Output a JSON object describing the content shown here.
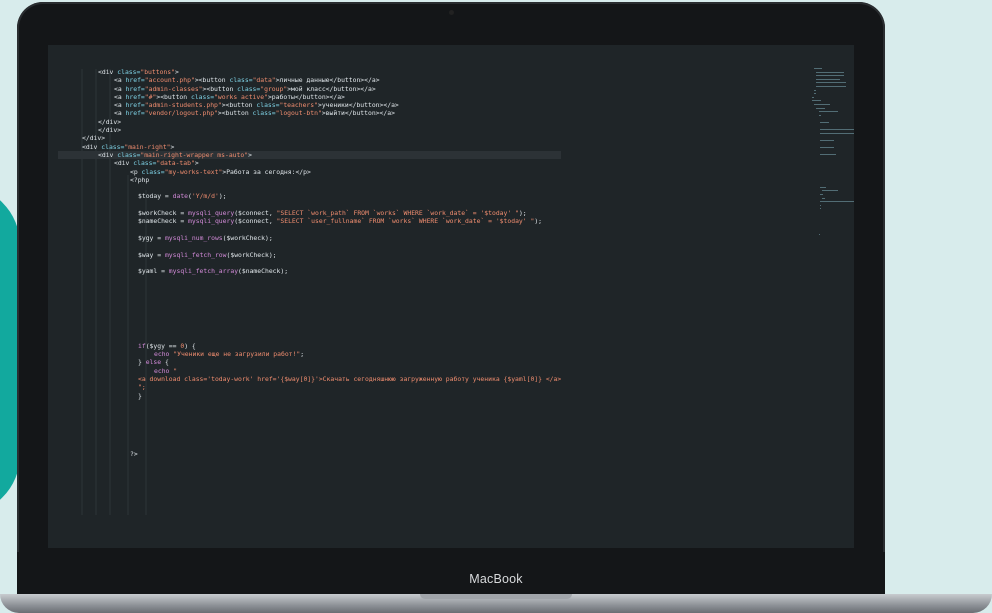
{
  "device": {
    "brand_label": "MacBook"
  },
  "colors": {
    "screen_bg": "#1f2528",
    "tag": "#e0e6ea",
    "attr": "#7fd3e6",
    "string": "#f08d6f",
    "function": "#d28ad8"
  },
  "code_lines": [
    {
      "indent": 5,
      "parts": [
        [
          "tg",
          "<div "
        ],
        [
          "at",
          "class="
        ],
        [
          "st",
          "\"buttons\""
        ],
        [
          "tg",
          ">"
        ]
      ]
    },
    {
      "indent": 7,
      "parts": [
        [
          "tg",
          "<a "
        ],
        [
          "at",
          "href="
        ],
        [
          "st",
          "\"account.php\""
        ],
        [
          "tg",
          "><button "
        ],
        [
          "at",
          "class="
        ],
        [
          "st",
          "\"data\""
        ],
        [
          "tg",
          ">личные данные</button></a>"
        ]
      ]
    },
    {
      "indent": 7,
      "parts": [
        [
          "tg",
          "<a "
        ],
        [
          "at",
          "href="
        ],
        [
          "st",
          "\"admin-classes\""
        ],
        [
          "tg",
          "><button "
        ],
        [
          "at",
          "class="
        ],
        [
          "st",
          "\"group\""
        ],
        [
          "tg",
          ">мой класс</button></a>"
        ]
      ]
    },
    {
      "indent": 7,
      "parts": [
        [
          "tg",
          "<a "
        ],
        [
          "at",
          "href="
        ],
        [
          "st",
          "\"#\""
        ],
        [
          "tg",
          "><button "
        ],
        [
          "at",
          "class="
        ],
        [
          "st",
          "\"works active\""
        ],
        [
          "tg",
          ">работы</button></a>"
        ]
      ]
    },
    {
      "indent": 7,
      "parts": [
        [
          "tg",
          "<a "
        ],
        [
          "at",
          "href="
        ],
        [
          "st",
          "\"admin-students.php\""
        ],
        [
          "tg",
          "><button "
        ],
        [
          "at",
          "class="
        ],
        [
          "st",
          "\"teachers\""
        ],
        [
          "tg",
          ">ученики</button></a>"
        ]
      ]
    },
    {
      "indent": 7,
      "parts": [
        [
          "tg",
          "<a "
        ],
        [
          "at",
          "href="
        ],
        [
          "st",
          "\"vendor/logout.php\""
        ],
        [
          "tg",
          "><button "
        ],
        [
          "at",
          "class="
        ],
        [
          "st",
          "\"logout-btn\""
        ],
        [
          "tg",
          ">выйти</button></a>"
        ]
      ]
    },
    {
      "indent": 5,
      "parts": [
        [
          "tg",
          "</div>"
        ]
      ]
    },
    {
      "indent": 5,
      "parts": [
        [
          "tg",
          "</div>"
        ]
      ]
    },
    {
      "indent": 3,
      "parts": [
        [
          "tg",
          "</div>"
        ]
      ]
    },
    {
      "indent": 3,
      "parts": [
        [
          "tg",
          "<div "
        ],
        [
          "at",
          "class="
        ],
        [
          "st",
          "\"main-right\""
        ],
        [
          "tg",
          ">"
        ]
      ]
    },
    {
      "indent": 5,
      "hl": true,
      "parts": [
        [
          "tg",
          "<div "
        ],
        [
          "at",
          "class="
        ],
        [
          "st",
          "\"main-right-wrapper ms-auto\""
        ],
        [
          "tg",
          ">"
        ]
      ]
    },
    {
      "indent": 7,
      "parts": [
        [
          "tg",
          "<div "
        ],
        [
          "at",
          "class="
        ],
        [
          "st",
          "\"data-tab\""
        ],
        [
          "tg",
          ">"
        ]
      ]
    },
    {
      "indent": 9,
      "parts": [
        [
          "tg",
          "<p "
        ],
        [
          "at",
          "class="
        ],
        [
          "st",
          "\"my-works-text\""
        ],
        [
          "tg",
          ">Работа за сегодня:</p>"
        ]
      ]
    },
    {
      "indent": 9,
      "parts": [
        [
          "tg",
          "<?php"
        ]
      ]
    },
    {
      "indent": 0,
      "parts": []
    },
    {
      "indent": 10,
      "parts": [
        [
          "vr",
          "$today = "
        ],
        [
          "fn",
          "date"
        ],
        [
          "vr",
          "("
        ],
        [
          "st",
          "'Y/m/d'"
        ],
        [
          "vr",
          ");"
        ]
      ]
    },
    {
      "indent": 0,
      "parts": []
    },
    {
      "indent": 10,
      "parts": [
        [
          "vr",
          "$workCheck = "
        ],
        [
          "fn",
          "mysqli_query"
        ],
        [
          "vr",
          "($connect, "
        ],
        [
          "st",
          "\"SELECT `work_path` FROM `works` WHERE `work_date` = '$today' \""
        ],
        [
          "vr",
          ");"
        ]
      ]
    },
    {
      "indent": 10,
      "parts": [
        [
          "vr",
          "$nameCheck = "
        ],
        [
          "fn",
          "mysqli_query"
        ],
        [
          "vr",
          "($connect, "
        ],
        [
          "st",
          "\"SELECT `user_fullname` FROM `works` WHERE `work_date` = '$today' \""
        ],
        [
          "vr",
          ");"
        ]
      ]
    },
    {
      "indent": 0,
      "parts": []
    },
    {
      "indent": 10,
      "parts": [
        [
          "vr",
          "$ygy = "
        ],
        [
          "fn",
          "mysqli_num_rows"
        ],
        [
          "vr",
          "($workCheck);"
        ]
      ]
    },
    {
      "indent": 0,
      "parts": []
    },
    {
      "indent": 10,
      "parts": [
        [
          "vr",
          "$way = "
        ],
        [
          "fn",
          "mysqli_fetch_row"
        ],
        [
          "vr",
          "($workCheck);"
        ]
      ]
    },
    {
      "indent": 0,
      "parts": []
    },
    {
      "indent": 10,
      "parts": [
        [
          "vr",
          "$yaml = "
        ],
        [
          "fn",
          "mysqli_fetch_array"
        ],
        [
          "vr",
          "($nameCheck);"
        ]
      ]
    },
    {
      "indent": 0,
      "parts": []
    },
    {
      "indent": 0,
      "parts": []
    },
    {
      "indent": 0,
      "parts": []
    },
    {
      "indent": 0,
      "parts": []
    },
    {
      "indent": 0,
      "parts": []
    },
    {
      "indent": 0,
      "parts": []
    },
    {
      "indent": 0,
      "parts": []
    },
    {
      "indent": 0,
      "parts": []
    },
    {
      "indent": 10,
      "parts": [
        [
          "kw",
          "if"
        ],
        [
          "vr",
          "($ygy == "
        ],
        [
          "nm",
          "0"
        ],
        [
          "vr",
          ") {"
        ]
      ]
    },
    {
      "indent": 12,
      "parts": [
        [
          "kw",
          "echo "
        ],
        [
          "st",
          "\"Ученики еще не загрузили работ!\""
        ],
        [
          "vr",
          ";"
        ]
      ]
    },
    {
      "indent": 10,
      "parts": [
        [
          "vr",
          "} "
        ],
        [
          "kw",
          "else"
        ],
        [
          "vr",
          " {"
        ]
      ]
    },
    {
      "indent": 12,
      "parts": [
        [
          "kw",
          "echo "
        ],
        [
          "st",
          "\""
        ]
      ]
    },
    {
      "indent": 10,
      "parts": [
        [
          "st",
          "<a download class='today-work' href='{$way[0]}'>Скачать сегодняшнюю загруженную работу ученика {$yaml[0]} </a>"
        ]
      ]
    },
    {
      "indent": 10,
      "parts": [
        [
          "st",
          "\";"
        ]
      ]
    },
    {
      "indent": 10,
      "parts": [
        [
          "vr",
          "}"
        ]
      ]
    },
    {
      "indent": 0,
      "parts": []
    },
    {
      "indent": 0,
      "parts": []
    },
    {
      "indent": 0,
      "parts": []
    },
    {
      "indent": 0,
      "parts": []
    },
    {
      "indent": 0,
      "parts": []
    },
    {
      "indent": 0,
      "parts": []
    },
    {
      "indent": 9,
      "parts": [
        [
          "vr",
          "?>"
        ]
      ]
    }
  ]
}
